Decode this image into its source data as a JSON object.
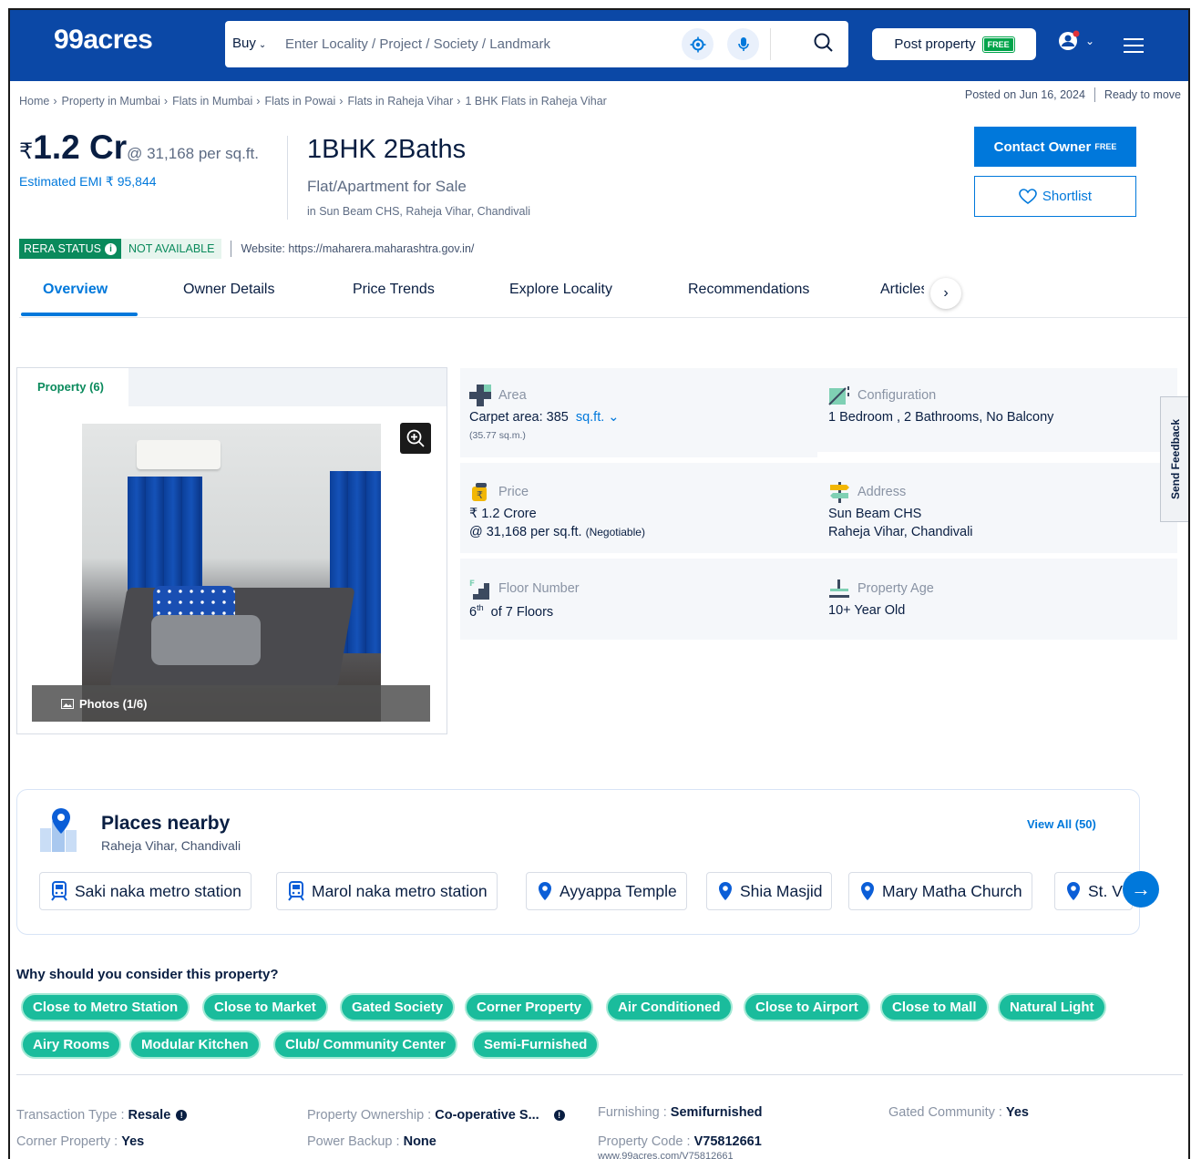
{
  "header": {
    "logo": "99acres",
    "buy_label": "Buy",
    "search_placeholder": "Enter Locality / Project / Society / Landmark",
    "post_property_label": "Post property",
    "free_tag": "FREE"
  },
  "breadcrumb": [
    "Home",
    "Property in Mumbai",
    "Flats in Mumbai",
    "Flats in Powai",
    "Flats in Raheja Vihar",
    "1 BHK Flats in Raheja Vihar"
  ],
  "posted": {
    "date": "Posted on Jun 16, 2024",
    "status": "Ready to move"
  },
  "listing": {
    "rupee": "₹",
    "price": "1.2 Cr",
    "price_per_sqft": "@ 31,168 per sq.ft.",
    "emi": "Estimated EMI ₹ 95,844",
    "title": "1BHK 2Baths",
    "type": "Flat/Apartment for Sale",
    "location": "in Sun Beam CHS, Raheja Vihar, Chandivali"
  },
  "actions": {
    "contact_owner": "Contact Owner",
    "contact_free": "FREE",
    "shortlist": "Shortlist"
  },
  "rera": {
    "badge": "RERA STATUS",
    "status": "NOT AVAILABLE",
    "website": "Website: https://maharera.maharashtra.gov.in/"
  },
  "tabs": [
    "Overview",
    "Owner Details",
    "Price Trends",
    "Explore Locality",
    "Recommendations",
    "Articles"
  ],
  "gallery": {
    "tab_label": "Property (6)",
    "photos_label": "Photos (1/6)"
  },
  "details": {
    "area_label": "Area",
    "area_value": "Carpet area: 385",
    "area_unit": "sq.ft.",
    "area_sqm": "(35.77 sq.m.)",
    "config_label": "Configuration",
    "config_value": "1 Bedroom , 2 Bathrooms, No Balcony",
    "price_label": "Price",
    "price_value": "₹ 1.2 Crore",
    "price_psf": "@ 31,168 per sq.ft.",
    "price_negotiable": "(Negotiable)",
    "address_label": "Address",
    "address_line1": "Sun Beam CHS",
    "address_line2": "Raheja Vihar, Chandivali",
    "floor_label": "Floor Number",
    "floor_num": "6",
    "floor_sup": "th",
    "floor_of": "of 7 Floors",
    "age_label": "Property Age",
    "age_value": "10+ Year Old"
  },
  "feedback": "Send Feedback",
  "places": {
    "title": "Places nearby",
    "subtitle": "Raheja Vihar, Chandivali",
    "view_all": "View All (50)",
    "items": [
      {
        "name": "Saki naka metro station",
        "icon": "metro-icon"
      },
      {
        "name": "Marol naka metro station",
        "icon": "metro-icon"
      },
      {
        "name": "Ayyappa Temple",
        "icon": "location-pin-icon"
      },
      {
        "name": "Shia Masjid",
        "icon": "location-pin-icon"
      },
      {
        "name": "Mary Matha Church",
        "icon": "location-pin-icon"
      },
      {
        "name": "St. V",
        "icon": "location-pin-icon"
      }
    ]
  },
  "why": {
    "title": "Why should you consider this property?",
    "tags": [
      "Close to Metro Station",
      "Close to Market",
      "Gated Society",
      "Corner Property",
      "Air Conditioned",
      "Close to Airport",
      "Close to Mall",
      "Natural Light",
      "Airy Rooms",
      "Modular Kitchen",
      "Club/ Community Center",
      "Semi-Furnished"
    ]
  },
  "facts": {
    "transaction_label": "Transaction Type",
    "transaction_value": "Resale",
    "ownership_label": "Property Ownership",
    "ownership_value": "Co-operative S...",
    "furnishing_label": "Furnishing",
    "furnishing_value": "Semifurnished",
    "gated_label": "Gated Community",
    "gated_value": "Yes",
    "corner_label": "Corner Property",
    "corner_value": "Yes",
    "power_label": "Power Backup",
    "power_value": "None",
    "code_label": "Property Code",
    "code_value": "V75812661",
    "url": "www.99acres.com/V75812661"
  },
  "colors": {
    "header_blue": "#0b48a6",
    "accent_blue": "#0078db",
    "rera_green": "#0a8a5c",
    "tag_teal": "#1abc9c"
  }
}
